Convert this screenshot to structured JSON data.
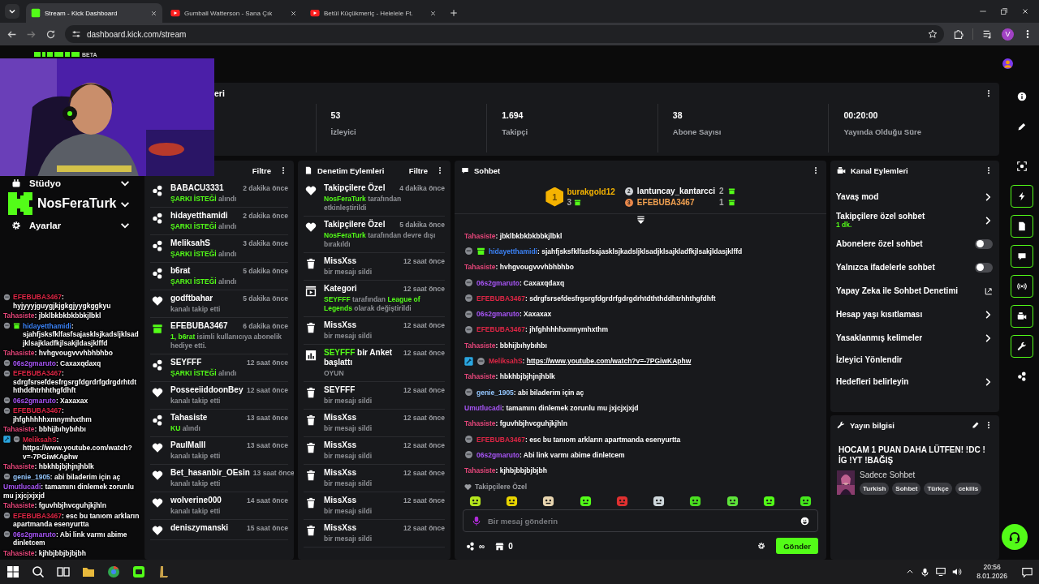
{
  "browser": {
    "tabs": [
      {
        "title": "Stream - Kick Dashboard",
        "kind": "kick",
        "selected": true
      },
      {
        "title": "Gumball Watterson - Sana Çık",
        "kind": "youtube",
        "selected": false
      },
      {
        "title": "Betül Küçükmeriç - Helelele Ft.",
        "kind": "youtube",
        "selected": false
      }
    ],
    "forward": {
      "disabled": true
    },
    "address": "dashboard.kick.com/stream",
    "profile": "V"
  },
  "header": {
    "badge": "BETA"
  },
  "sidebar": {
    "items": [
      {
        "label": "Stüdyo",
        "kind": "studio",
        "expanded": false
      },
      {
        "kind": "blank",
        "expanded": false
      },
      {
        "label": "Ayarlar",
        "kind": "settings",
        "expanded": false
      }
    ]
  },
  "channel_overlay": {
    "name": "NosFeraTurk"
  },
  "stats": {
    "title": "eri",
    "items": [
      {
        "value": "53",
        "label": "İzleyici"
      },
      {
        "value": "1.694",
        "label": "Takipçi"
      },
      {
        "value": "38",
        "label": "Abone Sayısı"
      },
      {
        "value": "00:20:00",
        "label": "Yayında Olduğu Süre"
      }
    ]
  },
  "activity_feed": {
    "filter": "Filtre",
    "items": [
      {
        "kind": "song",
        "user": "BABACU3331",
        "time": "2 dakika önce",
        "text": "**ŞARKI İSTEĞİ** alındı"
      },
      {
        "kind": "song",
        "user": "hidayetthamidi",
        "time": "2 dakika önce",
        "text": "**ŞARKI İSTEĞİ** alındı"
      },
      {
        "kind": "song",
        "user": "MeliksahS",
        "time": "3 dakika önce",
        "text": "**ŞARKI İSTEĞİ** alındı"
      },
      {
        "kind": "song",
        "user": "b6rat",
        "time": "5 dakika önce",
        "text": "**ŞARKI İSTEĞİ** alındı"
      },
      {
        "kind": "follow",
        "user": "godftbahar",
        "time": "5 dakika önce",
        "text": "kanalı takip etti"
      },
      {
        "kind": "gift",
        "user": "EFEBUBA3467",
        "time": "6 dakika önce",
        "text": "**1, b6rat** isimli kullanıcıya abonelik hediye etti."
      },
      {
        "kind": "song",
        "user": "SEYFFF",
        "time": "12 saat önce",
        "text": "**ŞARKI İSTEĞİ** alındı"
      },
      {
        "kind": "follow",
        "user": "PosseeiiddoonBey",
        "time": "12 saat önce",
        "text": "kanalı takip etti"
      },
      {
        "kind": "song",
        "user": "Tahasiste",
        "time": "13 saat önce",
        "text": "**KU** alındı"
      },
      {
        "kind": "follow",
        "user": "PaulMalll",
        "time": "13 saat önce",
        "text": "kanalı takip etti"
      },
      {
        "kind": "follow",
        "user": "Bet_hasanbir_OEsin",
        "time": "13 saat önce",
        "text": "kanalı takip etti"
      },
      {
        "kind": "follow",
        "user": "wolverine000",
        "time": "14 saat önce",
        "text": "kanalı takip etti"
      },
      {
        "kind": "follow",
        "user": "deniszymanski",
        "time": "15 saat önce"
      }
    ]
  },
  "mod_log": {
    "title": "Denetim Eylemleri",
    "filter": "Filtre",
    "items": [
      {
        "kind": "follow",
        "title": "Takipçilere Özel",
        "time": "4 dakika önce",
        "text": "**NosFeraTurk** tarafından etkinleştirildi"
      },
      {
        "kind": "follow",
        "title": "Takipçilere Özel",
        "time": "5 dakika önce",
        "text": "**NosFeraTurk** tarafından devre dışı bırakıldı"
      },
      {
        "kind": "delete",
        "title": "MissXss",
        "time": "12 saat önce",
        "text": "bir mesajı sildi"
      },
      {
        "kind": "category",
        "title": "Kategori",
        "time": "12 saat önce",
        "text": "**SEYFFF** tarafından **League of Legends** olarak değiştirildi"
      },
      {
        "kind": "delete",
        "title": "MissXss",
        "time": "12 saat önce",
        "text": "bir mesajı sildi"
      },
      {
        "kind": "poll",
        "title": "**SEYFFF** bir Anket başlattı",
        "time": "12 saat önce",
        "text": "OYUN"
      },
      {
        "kind": "delete",
        "title": "SEYFFF",
        "time": "12 saat önce",
        "text": "bir mesajı sildi"
      },
      {
        "kind": "delete",
        "title": "MissXss",
        "time": "12 saat önce",
        "text": "bir mesajı sildi"
      },
      {
        "kind": "delete",
        "title": "MissXss",
        "time": "12 saat önce",
        "text": "bir mesajı sildi"
      },
      {
        "kind": "delete",
        "title": "MissXss",
        "time": "12 saat önce",
        "text": "bir mesajı sildi"
      },
      {
        "kind": "delete",
        "title": "MissXss",
        "time": "12 saat önce",
        "text": "bir mesajı sildi"
      },
      {
        "kind": "delete",
        "title": "MissXss",
        "time": "12 saat önce",
        "text": "bir mesajı sildi"
      }
    ]
  },
  "chat": {
    "title": "Sohbet",
    "leaderboard": [
      {
        "rank": "1",
        "user": "burakgold12",
        "count": "3"
      },
      {
        "rank": "2",
        "user": "lantuncay_kantarcci",
        "count": "2"
      },
      {
        "rank": "3",
        "user": "EFEBUBA3467",
        "count": "1"
      }
    ],
    "messages": [
      {
        "kind": "text",
        "user": "Tahasiste",
        "color": "#e5467a",
        "text": ": jbklbkbkbkbbkjlbkl",
        "moderator": false,
        "subscriber": false,
        "gifter": false
      },
      {
        "kind": "text",
        "user": "hidayetthamidi",
        "color": "#3b82f6",
        "text": ": sjahfjsksfklfasfsajasklsjkadsljklsadjklsajkladfkjlsakjldasjklffd",
        "moderator": false,
        "subscriber": true,
        "gifter": true
      },
      {
        "kind": "text",
        "user": "Tahasiste",
        "color": "#e5467a",
        "text": ": hvhgvougvvvhbhbhbo",
        "moderator": false,
        "subscriber": false,
        "gifter": false
      },
      {
        "kind": "text",
        "user": "06s2gmaruto",
        "color": "#a855f7",
        "text": ": Caxaxqdaxq",
        "moderator": false,
        "subscriber": true,
        "gifter": false
      },
      {
        "kind": "text",
        "user": "EFEBUBA3467",
        "color": "#dc2645",
        "text": ": sdrgfsrsefdesfrgsrgfdgrdrfgdrgdrhtdththddhtrhhthgfdhft",
        "moderator": false,
        "subscriber": true,
        "gifter": false
      },
      {
        "kind": "text",
        "user": "06s2gmaruto",
        "color": "#a855f7",
        "text": ": Xaxaxax",
        "moderator": false,
        "subscriber": true,
        "gifter": false
      },
      {
        "kind": "text",
        "user": "EFEBUBA3467",
        "color": "#dc2645",
        "text": ": jhfghhhhhxmnymhxthm",
        "moderator": false,
        "subscriber": true,
        "gifter": false
      },
      {
        "kind": "text",
        "user": "Tahasiste",
        "color": "#e5467a",
        "text": ": bbhijbıhybıhbı",
        "moderator": false,
        "subscriber": false,
        "gifter": false
      },
      {
        "kind": "link",
        "user": "MeliksahS",
        "color": "#dc2645",
        "text": ": ",
        "link": "https://www.youtube.com/watch?v=-7PGiwKAphw",
        "moderator": true,
        "subscriber": true,
        "gifter": false
      },
      {
        "kind": "text",
        "user": "Tahasiste",
        "color": "#e5467a",
        "text": ": hbkhbjbjhjnjhblk",
        "moderator": false,
        "subscriber": false,
        "gifter": false
      },
      {
        "kind": "text",
        "user": "genie_1905",
        "color": "#93c5fd",
        "text": ": abi biladerim için aç",
        "moderator": false,
        "subscriber": true,
        "gifter": false
      },
      {
        "kind": "text",
        "user": "Umutlucadi",
        "color": "#a855f7",
        "text": ": tamamını dinlemek zorunlu mu jxjcjxjxjd",
        "moderator": false,
        "subscriber": false,
        "gifter": false
      },
      {
        "kind": "text",
        "user": "Tahasiste",
        "color": "#e5467a",
        "text": ": fguvhbjhvcguhjkjhln",
        "moderator": false,
        "subscriber": false,
        "gifter": false
      },
      {
        "kind": "text",
        "user": "EFEBUBA3467",
        "color": "#dc2645",
        "text": ": esc bu tanıom arkların apartmanda esenyurtta",
        "moderator": false,
        "subscriber": true,
        "gifter": false
      },
      {
        "kind": "text",
        "user": "06s2gmaruto",
        "color": "#a855f7",
        "text": ": Abi link varmı abime dinletcem",
        "moderator": false,
        "subscriber": true,
        "gifter": false
      },
      {
        "kind": "text",
        "user": "Tahasiste",
        "color": "#e5467a",
        "text": ": kjhbjbbjbjbjbh",
        "moderator": false,
        "subscriber": false,
        "gifter": false
      }
    ],
    "emote_label": "Takipçilere Özel",
    "emotes": [
      {
        "color": "#b5e61d"
      },
      {
        "color": "#e8d400"
      },
      {
        "color": "#e8d5b0"
      },
      {
        "color": "#53fc18"
      },
      {
        "color": "#e03030"
      },
      {
        "color": "#cfd8dc"
      },
      {
        "color": "#4ade20"
      },
      {
        "color": "#5ee33a"
      },
      {
        "color": "#53fc18"
      },
      {
        "color": "#45e81c"
      }
    ],
    "placeholder": "Bir mesaj gönderin",
    "points": "∞",
    "store_count": "0",
    "send": "Gönder"
  },
  "channel_actions": {
    "title": "Kanal Eylemleri",
    "items": [
      {
        "kind": "submenu",
        "label": "Yavaş mod"
      },
      {
        "kind": "submenu",
        "label": "Takipçilere özel sohbet",
        "note": "1 dk."
      },
      {
        "kind": "toggle",
        "label": "Abonelere özel sohbet",
        "on": false
      },
      {
        "kind": "toggle",
        "label": "Yalnızca ifadelerle sohbet",
        "on": false
      },
      {
        "kind": "external",
        "label": "Yapay Zeka ile Sohbet Denetimi"
      },
      {
        "kind": "submenu",
        "label": "Hesap yaşı kısıtlaması"
      },
      {
        "kind": "submenu",
        "label": "Yasaklanmış kelimeler"
      },
      {
        "kind": "plain",
        "label": "İzleyici Yönlendir"
      },
      {
        "kind": "submenu",
        "label": "Hedefleri belirleyin"
      }
    ]
  },
  "stream_info": {
    "title": "Yayın bilgisi",
    "stream_title": "HOCAM 1 PUAN DAHA LÜTFEN! !DC !İG !YT !BAĞIŞ",
    "category": "Sadece Sohbet",
    "tags": [
      "Turkish",
      "Sohbet",
      "Türkçe",
      "cekilis"
    ]
  },
  "rail": [
    {
      "kind": "info",
      "active": false
    },
    {
      "kind": "edit",
      "active": false
    },
    {
      "kind": "screenshot",
      "active": false
    },
    {
      "kind": "bolt",
      "active": true
    },
    {
      "kind": "doc",
      "active": true
    },
    {
      "kind": "chat",
      "active": true
    },
    {
      "kind": "broadcast",
      "active": true
    },
    {
      "kind": "video",
      "active": true
    },
    {
      "kind": "wrench",
      "active": true
    },
    {
      "kind": "dots",
      "active": false
    }
  ],
  "stream_chat_overlay": [
    {
      "user": "EFEBUBA3467",
      "color": "#dc2645",
      "text": ": hyjyyyjguygjkjgkgjyygkggkyu",
      "moderator": false,
      "subscriber": true,
      "gifter": false
    },
    {
      "user": "Tahasiste",
      "color": "#e5467a",
      "text": ": jbklbkbkbkbbkjlbkl",
      "moderator": false,
      "subscriber": false,
      "gifter": false
    },
    {
      "user": "hidayetthamidi",
      "color": "#3b82f6",
      "text": ": sjahfjsksfklfasfsajasklsjkadsljklsadjklsajkladfkjlsakjldasjklffd",
      "moderator": false,
      "subscriber": true,
      "gifter": true
    },
    {
      "user": "Tahasiste",
      "color": "#e5467a",
      "text": ": hvhgvougvvvhbhbhbo",
      "moderator": false,
      "subscriber": false,
      "gifter": false
    },
    {
      "user": "06s2gmaruto",
      "color": "#a855f7",
      "text": ": Caxaxqdaxq",
      "moderator": false,
      "subscriber": true,
      "gifter": false
    },
    {
      "user": "EFEBUBA3467",
      "color": "#dc2645",
      "text": ": sdrgfsrsefdesfrgsrgfdgrdrfgdrgdrhtdththddhtrhhthgfdhft",
      "moderator": false,
      "subscriber": true,
      "gifter": false
    },
    {
      "user": "06s2gmaruto",
      "color": "#a855f7",
      "text": ": Xaxaxax",
      "moderator": false,
      "subscriber": true,
      "gifter": false
    },
    {
      "user": "EFEBUBA3467",
      "color": "#dc2645",
      "text": ": jhfghhhhhxmnymhxthm",
      "moderator": false,
      "subscriber": true,
      "gifter": false
    },
    {
      "user": "Tahasiste",
      "color": "#e5467a",
      "text": ": bbhijbıhybıhbı",
      "moderator": false,
      "subscriber": false,
      "gifter": false
    },
    {
      "user": "MeliksahS",
      "color": "#dc2645",
      "text": ": https://www.youtube.com/watch?v=-7PGiwKAphw",
      "moderator": true,
      "subscriber": true,
      "gifter": false
    },
    {
      "user": "Tahasiste",
      "color": "#e5467a",
      "text": ": hbkhbjbjhjnjhblk",
      "moderator": false,
      "subscriber": false,
      "gifter": false
    },
    {
      "user": "genie_1905",
      "color": "#93c5fd",
      "text": ": abi biladerim için aç",
      "moderator": false,
      "subscriber": true,
      "gifter": false
    },
    {
      "user": "Umutlucadi",
      "color": "#a855f7",
      "text": ": tamamını dinlemek zorunlu mu jxjcjxjxjd",
      "moderator": false,
      "subscriber": false,
      "gifter": false
    },
    {
      "user": "Tahasiste",
      "color": "#e5467a",
      "text": ": fguvhbjhvcguhjkjhln",
      "moderator": false,
      "subscriber": false,
      "gifter": false
    },
    {
      "user": "EFEBUBA3467",
      "color": "#dc2645",
      "text": ": esc bu tanıom arkların apartmanda esenyurtta",
      "moderator": false,
      "subscriber": true,
      "gifter": false
    },
    {
      "user": "06s2gmaruto",
      "color": "#a855f7",
      "text": ": Abi link varmı abime dinletcem",
      "moderator": false,
      "subscriber": true,
      "gifter": false
    },
    {
      "user": "Tahasiste",
      "color": "#e5467a",
      "text": ": kjhbjbbjbjbjbh",
      "moderator": false,
      "subscriber": false,
      "gifter": false
    }
  ],
  "taskbar": {
    "time": "20:56",
    "date": "8.01.2026"
  }
}
